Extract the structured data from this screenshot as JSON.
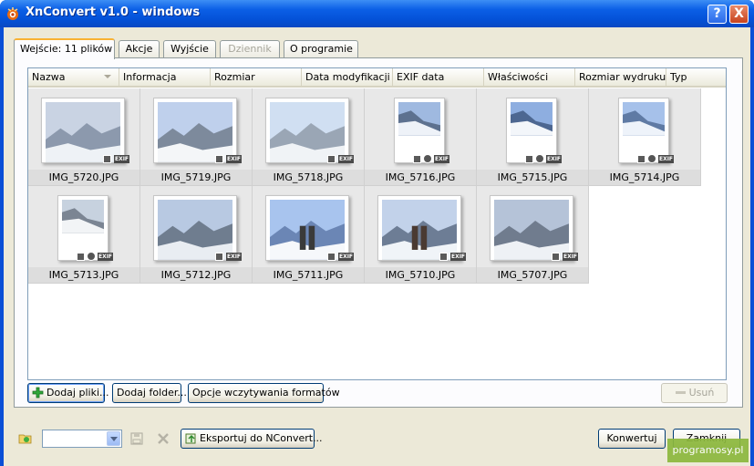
{
  "window": {
    "title": "XnConvert v1.0 - windows",
    "help_label": "?",
    "close_label": "X"
  },
  "tabs": [
    {
      "label": "Wejście: 11 plików",
      "active": true
    },
    {
      "label": "Akcje"
    },
    {
      "label": "Wyjście"
    },
    {
      "label": "Dziennik",
      "disabled": true
    },
    {
      "label": "O programie"
    }
  ],
  "columns": [
    "Nazwa",
    "Informacja",
    "Rozmiar",
    "Data modyfikacji",
    "EXIF data",
    "Właściwości",
    "Rozmiar wydruku",
    "Typ"
  ],
  "files": [
    {
      "name": "IMG_5720.JPG",
      "orientation": "landscape",
      "rotated": false
    },
    {
      "name": "IMG_5719.JPG",
      "orientation": "landscape",
      "rotated": false
    },
    {
      "name": "IMG_5718.JPG",
      "orientation": "landscape",
      "rotated": false
    },
    {
      "name": "IMG_5716.JPG",
      "orientation": "portrait",
      "rotated": true
    },
    {
      "name": "IMG_5715.JPG",
      "orientation": "portrait",
      "rotated": true
    },
    {
      "name": "IMG_5714.JPG",
      "orientation": "portrait",
      "rotated": true
    },
    {
      "name": "IMG_5713.JPG",
      "orientation": "portrait",
      "rotated": true
    },
    {
      "name": "IMG_5712.JPG",
      "orientation": "landscape",
      "rotated": false
    },
    {
      "name": "IMG_5711.JPG",
      "orientation": "landscape",
      "rotated": false
    },
    {
      "name": "IMG_5710.JPG",
      "orientation": "landscape",
      "rotated": false
    },
    {
      "name": "IMG_5707.JPG",
      "orientation": "landscape",
      "rotated": false
    }
  ],
  "badges": {
    "exif": "EXIF"
  },
  "buttons": {
    "add_files": "Dodaj pliki...",
    "add_folder": "Dodaj folder...",
    "read_options": "Opcje wczytywania formatów",
    "remove": "Usuń",
    "export": "Eksportuj do NConvert...",
    "convert": "Konwertuj",
    "close": "Zamknij"
  },
  "preset_combo": {
    "value": ""
  },
  "watermark": "programosy.pl"
}
